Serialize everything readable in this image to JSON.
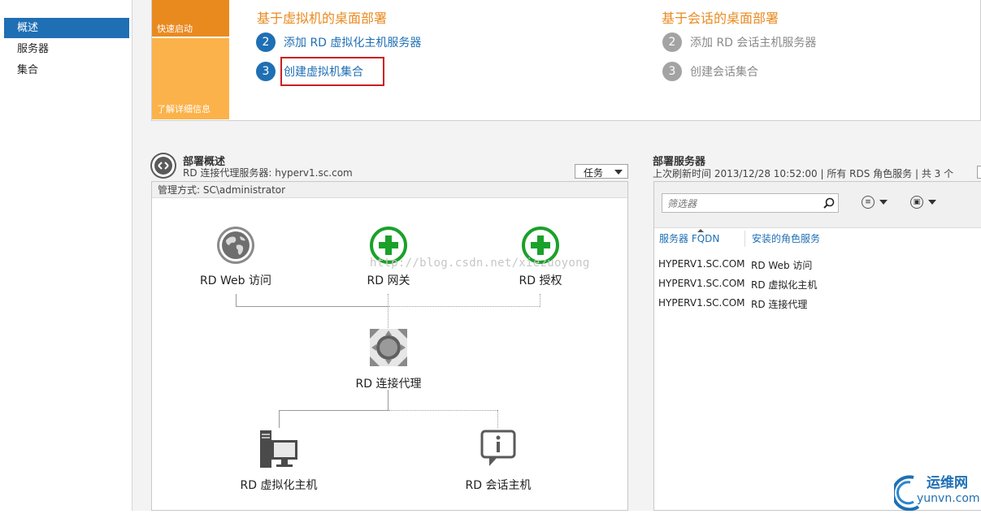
{
  "nav": {
    "items": [
      {
        "label": "概述",
        "active": true
      },
      {
        "label": "服务器",
        "active": false
      },
      {
        "label": "集合",
        "active": false
      }
    ]
  },
  "quick_start": {
    "tile_quick": "快速启动",
    "tile_learn": "了解详细信息",
    "vm_section": {
      "title": "基于虚拟机的桌面部署",
      "steps": [
        {
          "num": "2",
          "label": "添加 RD 虚拟化主机服务器"
        },
        {
          "num": "3",
          "label": "创建虚拟机集合"
        }
      ]
    },
    "session_section": {
      "title": "基于会话的桌面部署",
      "steps": [
        {
          "num": "2",
          "label": "添加 RD 会话主机服务器"
        },
        {
          "num": "3",
          "label": "创建会话集合"
        }
      ]
    }
  },
  "overview": {
    "title": "部署概述",
    "subtitle": "RD 连接代理服务器: hyperv1.sc.com",
    "tasks_label": "任务",
    "managed_by": "管理方式: SC\\administrator",
    "roles": {
      "web": "RD Web 访问",
      "gateway": "RD 网关",
      "licensing": "RD 授权",
      "broker": "RD 连接代理",
      "virt_host": "RD 虚拟化主机",
      "session_host": "RD 会话主机"
    },
    "watermark": "http://blog.csdn.net/xiezuoyong"
  },
  "servers": {
    "title": "部署服务器",
    "subtitle": "上次刷新时间 2013/12/28 10:52:00 | 所有 RDS 角色服务  | 共 3 个",
    "filter_placeholder": "筛选器",
    "columns": [
      "服务器 FQDN",
      "安装的角色服务"
    ],
    "rows": [
      {
        "fqdn": "HYPERV1.SC.COM",
        "role": "RD Web 访问"
      },
      {
        "fqdn": "HYPERV1.SC.COM",
        "role": "RD 虚拟化主机"
      },
      {
        "fqdn": "HYPERV1.SC.COM",
        "role": "RD 连接代理"
      }
    ]
  },
  "logo": {
    "text_cn": "运维网",
    "text_en": "yunvn.com"
  },
  "colors": {
    "accent_blue": "#1f6fb4",
    "accent_orange": "#e98a1f",
    "add_green": "#1aa12a",
    "highlight_red": "#cc1f1f"
  }
}
